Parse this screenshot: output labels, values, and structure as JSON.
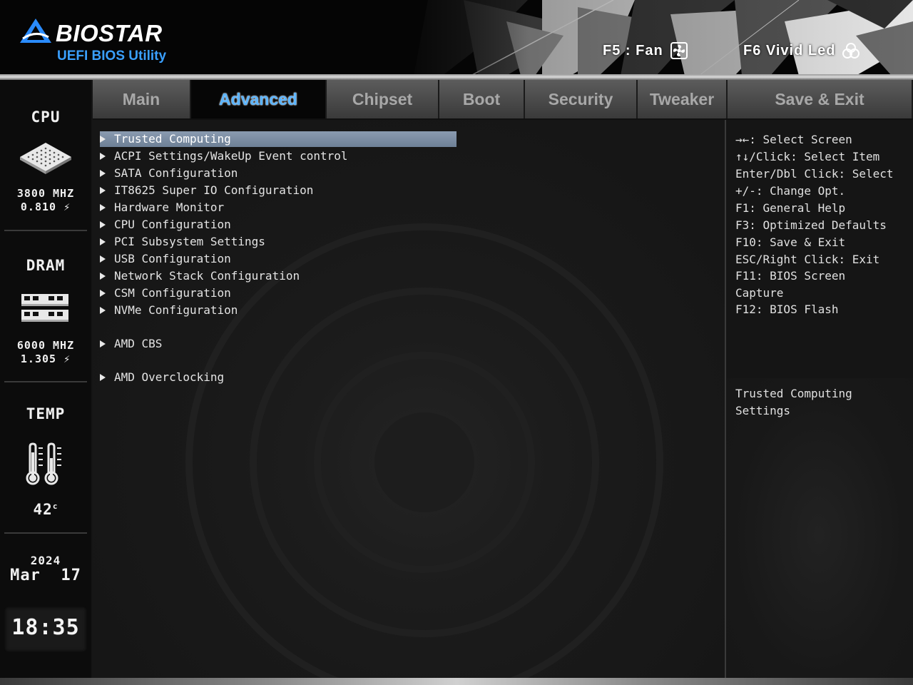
{
  "header": {
    "brand": "BIOSTAR",
    "subtitle": "UEFI BIOS Utility",
    "hotkeys": [
      {
        "label": "F5 : Fan",
        "icon": "fan-icon"
      },
      {
        "label": "F6  Vivid Led",
        "icon": "led-icon"
      }
    ]
  },
  "sidebar": {
    "cpu": {
      "title": "CPU",
      "freq": "3800 MHZ",
      "volt": "0.810",
      "icon": "cpu-chip-icon"
    },
    "dram": {
      "title": "DRAM",
      "freq": "6000 MHZ",
      "volt": "1.305",
      "icon": "memory-module-icon"
    },
    "temp": {
      "title": "TEMP",
      "value": "42",
      "unit": "c",
      "icon": "thermometer-icon"
    },
    "date": {
      "year": "2024",
      "month_day": "Mar  17"
    },
    "time": "18:35"
  },
  "tabs": [
    {
      "label": "Main",
      "active": false
    },
    {
      "label": "Advanced",
      "active": true
    },
    {
      "label": "Chipset",
      "active": false
    },
    {
      "label": "Boot",
      "active": false
    },
    {
      "label": "Security",
      "active": false
    },
    {
      "label": "Tweaker",
      "active": false
    },
    {
      "label": "Save & Exit",
      "active": false
    }
  ],
  "menu": [
    {
      "label": "Trusted Computing",
      "selected": true
    },
    {
      "label": "ACPI Settings/WakeUp Event control"
    },
    {
      "label": "SATA Configuration"
    },
    {
      "label": "IT8625 Super IO Configuration"
    },
    {
      "label": "Hardware Monitor"
    },
    {
      "label": "CPU Configuration"
    },
    {
      "label": "PCI Subsystem Settings"
    },
    {
      "label": "USB Configuration"
    },
    {
      "label": "Network Stack Configuration"
    },
    {
      "label": "CSM Configuration"
    },
    {
      "label": "NVMe Configuration"
    },
    {
      "label": "AMD CBS"
    },
    {
      "label": "AMD Overclocking"
    }
  ],
  "help_keys": [
    "→←: Select Screen",
    "↑↓/Click: Select Item",
    "Enter/Dbl Click: Select",
    "+/-: Change Opt.",
    "F1: General Help",
    "F3: Optimized Defaults",
    "F10: Save & Exit",
    "ESC/Right Click: Exit",
    "F11: BIOS Screen",
    "Capture",
    "F12: BIOS Flash"
  ],
  "description": [
    "Trusted Computing",
    "Settings"
  ],
  "colors": {
    "accent": "#5ab4ff",
    "brand_blue": "#3aa0ff",
    "selection": "#7a8ca2"
  }
}
